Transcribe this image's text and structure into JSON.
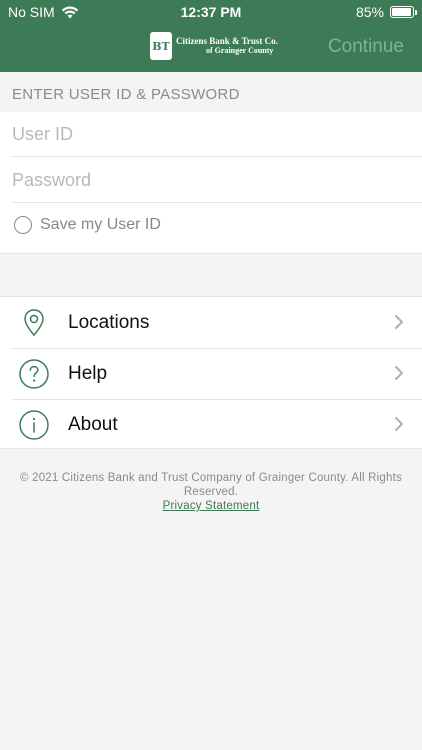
{
  "status_bar": {
    "carrier": "No SIM",
    "time": "12:37 PM",
    "battery_text": "85%",
    "battery_level": 0.85
  },
  "header": {
    "logo_mark": "BT",
    "logo_line1": "Citizens Bank & Trust Co.",
    "logo_line2": "of Grainger County",
    "continue_label": "Continue"
  },
  "login": {
    "heading": "ENTER USER ID & PASSWORD",
    "user_id_placeholder": "User ID",
    "user_id_value": "",
    "password_placeholder": "Password",
    "password_value": "",
    "save_label": "Save my User ID"
  },
  "menu": {
    "items": [
      {
        "label": "Locations",
        "icon": "location-pin-icon"
      },
      {
        "label": "Help",
        "icon": "question-icon"
      },
      {
        "label": "About",
        "icon": "info-icon"
      }
    ]
  },
  "footer": {
    "copyright": "© 2021 Citizens Bank and Trust Company of Grainger County. All Rights Reserved.",
    "privacy_link": "Privacy Statement"
  },
  "colors": {
    "brand": "#3d7a56",
    "continue_disabled": "#7fb394",
    "background": "#f4f4f4"
  }
}
